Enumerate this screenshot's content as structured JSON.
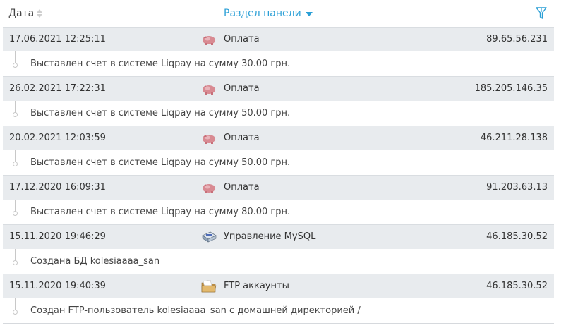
{
  "header": {
    "date_label": "Дата",
    "section_label": "Раздел панели"
  },
  "colors": {
    "accent": "#2a9fd6",
    "row_bg": "#e8ebee"
  },
  "rows": [
    {
      "date": "17.06.2021 12:25:11",
      "icon": "payment-icon",
      "section": "Оплата",
      "ip": "89.65.56.231",
      "detail": "Выставлен счет в системе Liqpay на сумму 30.00 грн."
    },
    {
      "date": "26.02.2021 17:22:31",
      "icon": "payment-icon",
      "section": "Оплата",
      "ip": "185.205.146.35",
      "detail": "Выставлен счет в системе Liqpay на сумму 50.00 грн."
    },
    {
      "date": "20.02.2021 12:03:59",
      "icon": "payment-icon",
      "section": "Оплата",
      "ip": "46.211.28.138",
      "detail": "Выставлен счет в системе Liqpay на сумму 50.00 грн."
    },
    {
      "date": "17.12.2020 16:09:31",
      "icon": "payment-icon",
      "section": "Оплата",
      "ip": "91.203.63.13",
      "detail": "Выставлен счет в системе Liqpay на сумму 80.00 грн."
    },
    {
      "date": "15.11.2020 19:46:29",
      "icon": "database-icon",
      "section": "Управление MySQL",
      "ip": "46.185.30.52",
      "detail": "Создана БД kolesiaaaa_san"
    },
    {
      "date": "15.11.2020 19:40:39",
      "icon": "ftp-folder-icon",
      "section": "FTP аккаунты",
      "ip": "46.185.30.52",
      "detail": "Создан FTP-пользователь kolesiaaaa_san с домашней директорией /"
    }
  ]
}
